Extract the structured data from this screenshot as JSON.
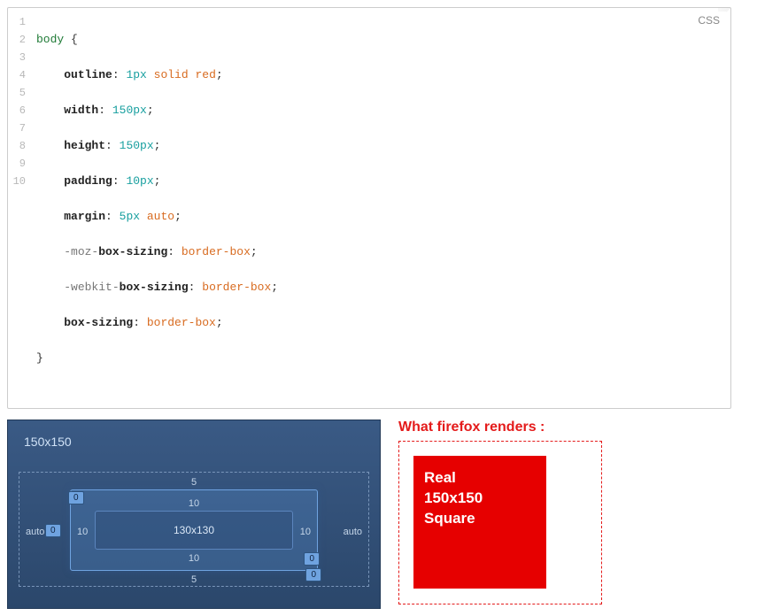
{
  "code_lang": "CSS",
  "gutter": {
    "l1": "1",
    "l2": "2",
    "l3": "3",
    "l4": "4",
    "l5": "5",
    "l6": "6",
    "l7": "7",
    "l8": "8",
    "l9": "9",
    "l10": "10"
  },
  "c": {
    "sel": "body",
    "open": "{",
    "close": "}",
    "indent": "    ",
    "colon": ": ",
    "semi": ";",
    "line2_prop": "outline",
    "line2_num": "1px",
    "line2_k1": "solid",
    "line2_k2": "red",
    "line3_prop": "width",
    "line3_num": "150px",
    "line4_prop": "height",
    "line4_num": "150px",
    "line5_prop": "padding",
    "line5_num": "10px",
    "line6_prop": "margin",
    "line6_num": "5px",
    "line6_k": "auto",
    "line7_vendor": "-moz-",
    "line7_prop": "box-sizing",
    "line7_v": "border-box",
    "line8_vendor": "-webkit-",
    "line8_prop": "box-sizing",
    "line8_v": "border-box",
    "line9_prop": "box-sizing",
    "line9_v": "border-box"
  },
  "boxmodel": {
    "dims": "150x150",
    "margin_top": "5",
    "margin_bottom": "5",
    "margin_left": "auto",
    "margin_right": "auto",
    "border_label_zero": "0",
    "padding_top": "10",
    "padding_bottom": "10",
    "padding_left": "10",
    "padding_right": "10",
    "inner": "130x130"
  },
  "firefox": {
    "heading": "What firefox renders :",
    "square_l1": "Real",
    "square_l2": "150x150",
    "square_l3": "Square"
  }
}
